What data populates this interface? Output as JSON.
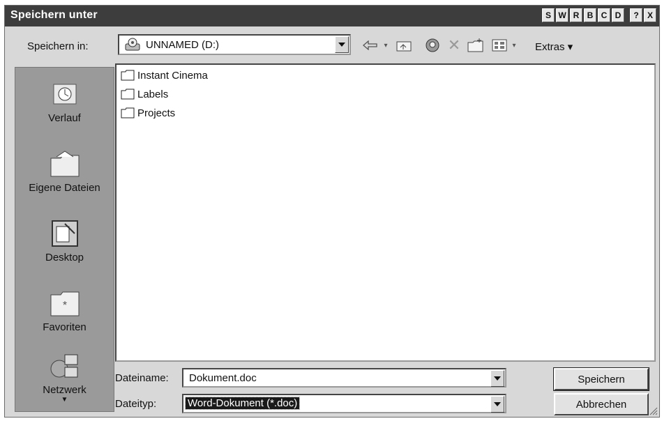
{
  "window": {
    "title": "Speichern unter"
  },
  "title_buttons": [
    "S",
    "W",
    "R",
    "B",
    "C",
    "D"
  ],
  "title_help": "?",
  "title_close": "X",
  "toolbar": {
    "lookin_label": "Speichern in:",
    "lookin_value": "UNNAMED (D:)",
    "extras_label": "Extras ▾"
  },
  "places": [
    {
      "label": "Verlauf",
      "icon": "history-icon"
    },
    {
      "label": "Eigene Dateien",
      "icon": "my-documents-icon"
    },
    {
      "label": "Desktop",
      "icon": "desktop-icon"
    },
    {
      "label": "Favoriten",
      "icon": "favorites-icon"
    },
    {
      "label": "Netzwerk",
      "icon": "network-icon"
    }
  ],
  "files": [
    "Instant Cinema",
    "Labels",
    "Projects"
  ],
  "filename": {
    "label": "Dateiname:",
    "value": "Dokument.doc"
  },
  "filetype": {
    "label": "Dateityp:",
    "value": "Word-Dokument (*.doc)"
  },
  "buttons": {
    "save": "Speichern",
    "cancel": "Abbrechen"
  }
}
